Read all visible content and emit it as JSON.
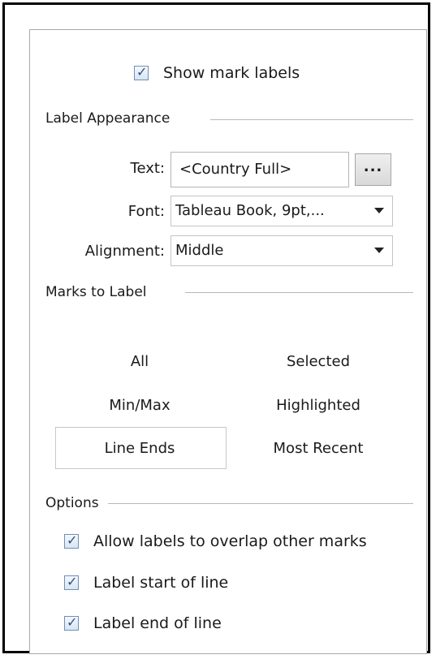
{
  "show_mark_labels": {
    "label": "Show mark labels",
    "checked": true
  },
  "label_appearance": {
    "title": "Label Appearance",
    "text": {
      "label": "Text:",
      "value": "<Country Full>",
      "button": "..."
    },
    "font": {
      "label": "Font:",
      "value": "Tableau Book, 9pt,..."
    },
    "alignment": {
      "label": "Alignment:",
      "value": "Middle"
    }
  },
  "marks_to_label": {
    "title": "Marks to Label",
    "options": [
      "All",
      "Selected",
      "Min/Max",
      "Highlighted",
      "Line Ends",
      "Most Recent"
    ],
    "selected": "Line Ends"
  },
  "options": {
    "title": "Options",
    "items": [
      {
        "label": "Allow labels to overlap other marks",
        "checked": true
      },
      {
        "label": "Label start of line",
        "checked": true
      },
      {
        "label": "Label end of line",
        "checked": true
      }
    ]
  }
}
